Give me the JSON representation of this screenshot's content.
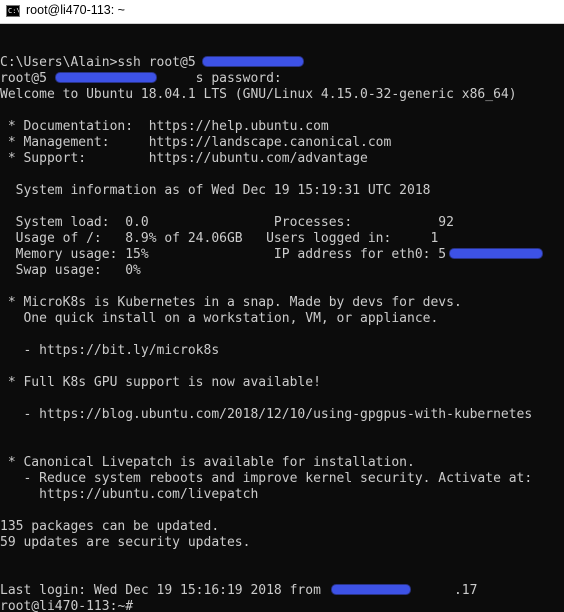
{
  "window": {
    "title": "root@li470-113: ~",
    "icon": "terminal-icon",
    "icon_glyph": "C:\\"
  },
  "colors": {
    "text": "#cccccc",
    "background": "#0c0c0c",
    "redaction": "#3d52e6"
  },
  "terminal": {
    "lines": [
      "",
      "C:\\Users\\Alain>ssh root@5",
      "root@5                   s password:",
      "Welcome to Ubuntu 18.04.1 LTS (GNU/Linux 4.15.0-32-generic x86_64)",
      "",
      " * Documentation:  https://help.ubuntu.com",
      " * Management:     https://landscape.canonical.com",
      " * Support:        https://ubuntu.com/advantage",
      "",
      "  System information as of Wed Dec 19 15:19:31 UTC 2018",
      "",
      "  System load:  0.0                Processes:           92",
      "  Usage of /:   8.9% of 24.06GB   Users logged in:     1",
      "  Memory usage: 15%                IP address for eth0: 5",
      "  Swap usage:   0%",
      "",
      " * MicroK8s is Kubernetes in a snap. Made by devs for devs.",
      "   One quick install on a workstation, VM, or appliance.",
      "",
      "   - https://bit.ly/microk8s",
      "",
      " * Full K8s GPU support is now available!",
      "",
      "   - https://blog.ubuntu.com/2018/12/10/using-gpgpus-with-kubernetes",
      "",
      "",
      " * Canonical Livepatch is available for installation.",
      "   - Reduce system reboots and improve kernel security. Activate at:",
      "     https://ubuntu.com/livepatch",
      "",
      "135 packages can be updated.",
      "59 updates are security updates.",
      "",
      "",
      "Last login: Wed Dec 19 15:16:19 2018 from                 .17",
      "root@li470-113:~#"
    ]
  }
}
